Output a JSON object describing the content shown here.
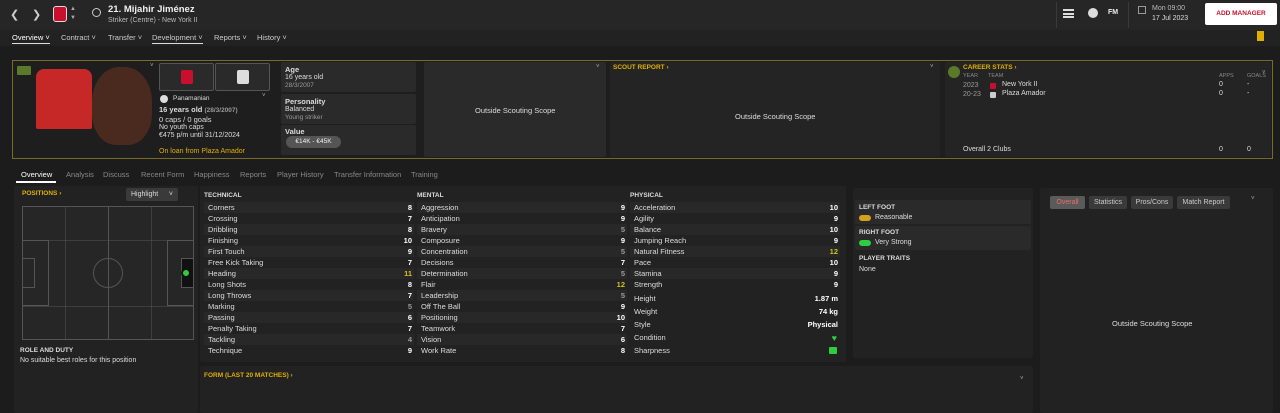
{
  "topbar": {
    "title": "21. Mijahir Jiménez",
    "subtitle": "Striker (Centre) - New York II",
    "date_day": "Mon 09:00",
    "date_full": "17 Jul 2023",
    "fm_logo": "FM",
    "add_manager": "ADD MANAGER"
  },
  "main_tabs": [
    "Overview",
    "Contract",
    "Transfer",
    "Development",
    "Reports",
    "History"
  ],
  "profile": {
    "nationality": "Panamanian",
    "age_line": "16 years old",
    "dob_short": "(28/3/2007)",
    "caps": "0 caps / 0 goals",
    "youth_caps": "No youth caps",
    "wage": "€475 p/m until 31/12/2024",
    "loan": "On loan from Plaza Amador"
  },
  "details": {
    "age_label": "Age",
    "age_value": "16 years old",
    "dob": "28/3/2007",
    "personality_label": "Personality",
    "personality_value": "Balanced",
    "personality_sub": "Young striker",
    "value_label": "Value",
    "value_range": "€14K - €45K"
  },
  "scouting": {
    "left_text": "Outside Scouting Scope",
    "scout_report_title": "SCOUT REPORT",
    "scout_report_text": "Outside Scouting Scope"
  },
  "career": {
    "title": "CAREER STATS",
    "hdr_year": "YEAR",
    "hdr_team": "TEAM",
    "hdr_apps": "APPS",
    "hdr_goals": "GOALS",
    "rows": [
      {
        "year": "2023",
        "team": "New York II",
        "apps": "0",
        "goals": "-"
      },
      {
        "year": "20-23",
        "team": "Plaza Amador",
        "apps": "0",
        "goals": "-"
      }
    ],
    "overall_label": "Overall 2 Clubs",
    "overall_apps": "0",
    "overall_goals": "0"
  },
  "sub_tabs": [
    "Overview",
    "Analysis",
    "Discuss",
    "Recent Form",
    "Happiness",
    "Reports",
    "Player History",
    "Transfer Information",
    "Training"
  ],
  "positions": {
    "title": "POSITIONS",
    "highlight": "Highlight",
    "role_title": "ROLE AND DUTY",
    "role_text": "No suitable best roles for this position"
  },
  "technical": {
    "title": "TECHNICAL",
    "attrs": [
      {
        "name": "Corners",
        "value": "8"
      },
      {
        "name": "Crossing",
        "value": "7"
      },
      {
        "name": "Dribbling",
        "value": "8"
      },
      {
        "name": "Finishing",
        "value": "10"
      },
      {
        "name": "First Touch",
        "value": "9"
      },
      {
        "name": "Free Kick Taking",
        "value": "7"
      },
      {
        "name": "Heading",
        "value": "11"
      },
      {
        "name": "Long Shots",
        "value": "8"
      },
      {
        "name": "Long Throws",
        "value": "7"
      },
      {
        "name": "Marking",
        "value": "5"
      },
      {
        "name": "Passing",
        "value": "6"
      },
      {
        "name": "Penalty Taking",
        "value": "7"
      },
      {
        "name": "Tackling",
        "value": "4"
      },
      {
        "name": "Technique",
        "value": "9"
      }
    ]
  },
  "mental": {
    "title": "MENTAL",
    "attrs": [
      {
        "name": "Aggression",
        "value": "9"
      },
      {
        "name": "Anticipation",
        "value": "9"
      },
      {
        "name": "Bravery",
        "value": "5"
      },
      {
        "name": "Composure",
        "value": "9"
      },
      {
        "name": "Concentration",
        "value": "5"
      },
      {
        "name": "Decisions",
        "value": "7"
      },
      {
        "name": "Determination",
        "value": "5"
      },
      {
        "name": "Flair",
        "value": "12"
      },
      {
        "name": "Leadership",
        "value": "5"
      },
      {
        "name": "Off The Ball",
        "value": "9"
      },
      {
        "name": "Positioning",
        "value": "10"
      },
      {
        "name": "Teamwork",
        "value": "7"
      },
      {
        "name": "Vision",
        "value": "6"
      },
      {
        "name": "Work Rate",
        "value": "8"
      }
    ]
  },
  "physical": {
    "title": "PHYSICAL",
    "attrs": [
      {
        "name": "Acceleration",
        "value": "10"
      },
      {
        "name": "Agility",
        "value": "9"
      },
      {
        "name": "Balance",
        "value": "10"
      },
      {
        "name": "Jumping Reach",
        "value": "9"
      },
      {
        "name": "Natural Fitness",
        "value": "12"
      },
      {
        "name": "Pace",
        "value": "10"
      },
      {
        "name": "Stamina",
        "value": "9"
      },
      {
        "name": "Strength",
        "value": "9"
      }
    ],
    "height_label": "Height",
    "height_value": "1.87 m",
    "weight_label": "Weight",
    "weight_value": "74 kg",
    "style_label": "Style",
    "style_value": "Physical",
    "condition_label": "Condition",
    "sharpness_label": "Sharpness"
  },
  "feet": {
    "left_title": "LEFT FOOT",
    "left_value": "Reasonable",
    "right_title": "RIGHT FOOT",
    "right_value": "Very Strong",
    "traits_title": "PLAYER TRAITS",
    "traits_value": "None"
  },
  "right_panel": {
    "tabs": [
      "Overall",
      "Statistics",
      "Pros/Cons",
      "Match Report"
    ],
    "text": "Outside Scouting Scope"
  },
  "form": {
    "title": "FORM (LAST 20 MATCHES)"
  },
  "colors": {
    "accent": "#e0b000",
    "highlight_attr": "#d4c020",
    "positive": "#2ecc40"
  }
}
